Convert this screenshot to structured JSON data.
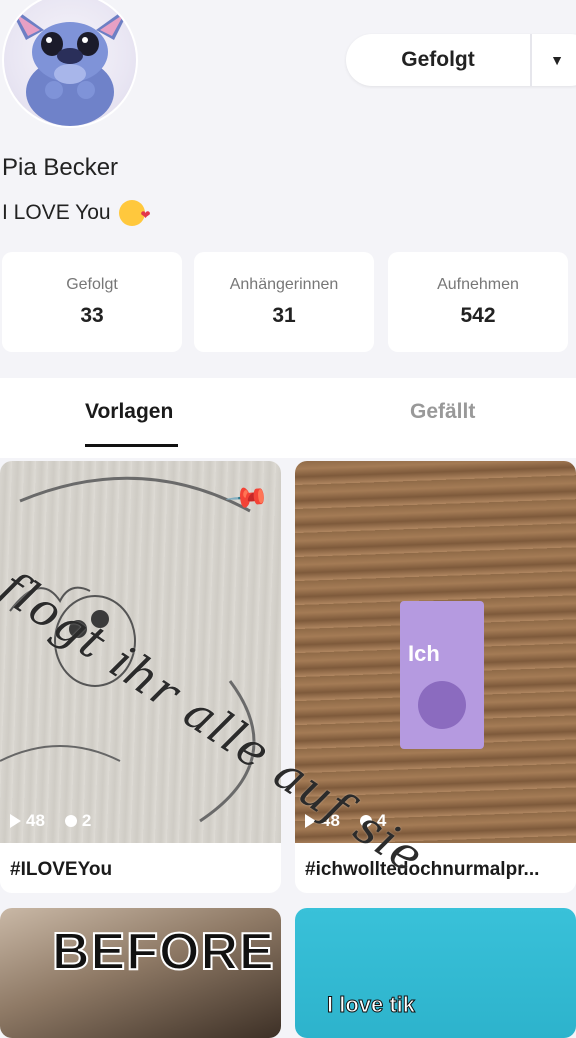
{
  "profile": {
    "name": "Pia Becker",
    "bio": "I LOVE You"
  },
  "header": {
    "follow_label": "Gefolgt",
    "dropdown_icon": "chevron-down-icon"
  },
  "stats": [
    {
      "label": "Gefolgt",
      "value": "33"
    },
    {
      "label": "Anhängerinnen",
      "value": "31"
    },
    {
      "label": "Aufnehmen",
      "value": "542"
    }
  ],
  "tabs": [
    {
      "label": "Vorlagen",
      "active": true
    },
    {
      "label": "Gefällt",
      "active": false
    }
  ],
  "overlay": {
    "text": "flogt ihr alle auf sie"
  },
  "cards": [
    {
      "caption": "#ILOVEYou",
      "plays": "48",
      "comments": "2",
      "pinned": true
    },
    {
      "caption": "#ichwolltedochnurmalpr...",
      "plays": "48",
      "comments": "4",
      "pinned": false
    },
    {
      "caption": "",
      "overlay_text": "BEFORE"
    },
    {
      "caption": "",
      "overlay_text": "I love tik"
    }
  ],
  "colors": {
    "background": "#f4f4f8",
    "card": "#ffffff",
    "accent": "#111111"
  }
}
